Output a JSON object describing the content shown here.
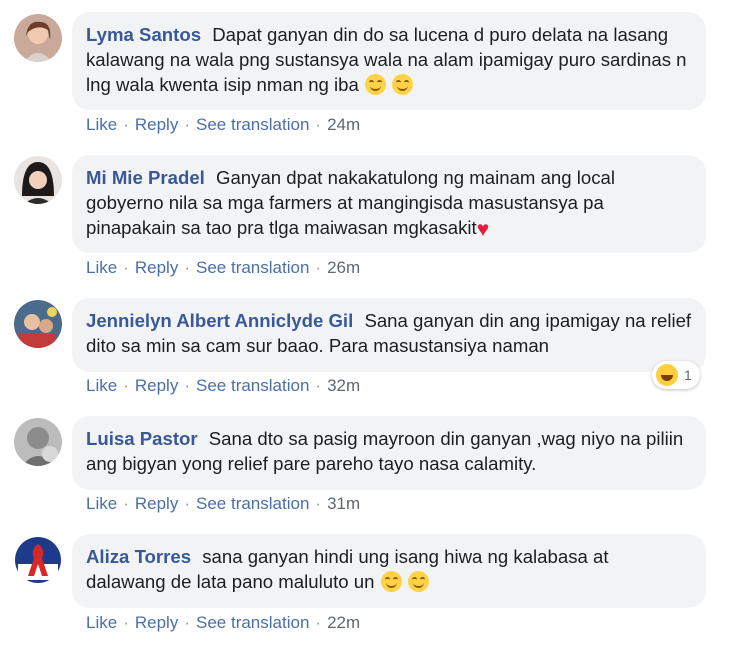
{
  "labels": {
    "like": "Like",
    "reply": "Reply",
    "see_translation": "See translation",
    "sep": "·"
  },
  "comments": [
    {
      "author": "Lyma Santos",
      "text": "Dapat ganyan din do sa lucena d puro delata na lasang kalawang na wala png sustansya wala na alam ipamigay puro sardinas n lng wala kwenta isip nman ng iba",
      "trailing": "emoji-grin-x2",
      "time": "24m"
    },
    {
      "author": "Mi Mie Pradel",
      "text": "Ganyan dpat nakakatulong ng mainam ang local gobyerno nila sa mga farmers at mangingisda masustansya pa pinapakain sa tao pra tlga maiwasan mgkasakit",
      "trailing": "heart",
      "time": "26m"
    },
    {
      "author": "Jennielyn Albert Anniclyde Gil",
      "text": "Sana ganyan din ang ipamigay na relief dito sa min sa cam sur baao. Para masustansiya naman",
      "trailing": "",
      "time": "32m",
      "reaction": {
        "icon": "haha-icon",
        "count": "1"
      }
    },
    {
      "author": "Luisa Pastor",
      "text": "Sana dto sa pasig mayroon din ganyan ,wag niyo na piliin ang bigyan yong relief pare pareho tayo nasa calamity.",
      "trailing": "",
      "time": "31m"
    },
    {
      "author": "Aliza Torres",
      "text": "sana ganyan hindi ung isang hiwa ng kalabasa at dalawang de lata pano maluluto un",
      "trailing": "emoji-smile-x2",
      "time": "22m"
    }
  ],
  "colors": {
    "author": "#385898",
    "bubble": "#f2f3f5",
    "link": "#4b6fa8",
    "muted": "#606770"
  }
}
